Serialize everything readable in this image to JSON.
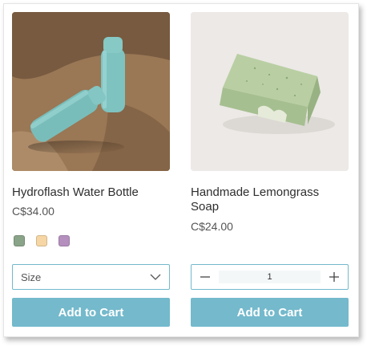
{
  "products": [
    {
      "name": "Hydroflash Water Bottle",
      "price": "C$34.00",
      "swatches": [
        {
          "name": "sage green",
          "color": "#8aa489"
        },
        {
          "name": "light peach",
          "color": "#f6d6a4"
        },
        {
          "name": "lavender",
          "color": "#b590bf"
        }
      ],
      "size_label": "Size",
      "button_label": "Add to Cart"
    },
    {
      "name": "Handmade Lemongrass Soap",
      "price": "C$24.00",
      "quantity": "1",
      "button_label": "Add to Cart"
    }
  ],
  "colors": {
    "accent": "#74b9cc",
    "text": "#2f2e2e",
    "price": "#555555"
  },
  "icons": {
    "select": "chevron-down-icon",
    "qty_decrease": "minus-icon",
    "qty_increase": "plus-icon"
  }
}
